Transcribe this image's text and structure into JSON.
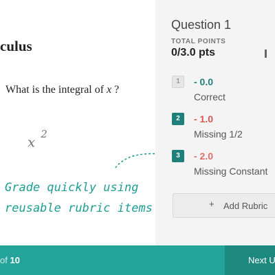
{
  "document": {
    "title": "culus",
    "question_prefix": "What is the integral of ",
    "question_var": "x",
    "question_suffix": " ?",
    "answer_base": "x",
    "answer_exponent": "2"
  },
  "annotation": {
    "line1": "Grade quickly using",
    "line2": "reusable rubric items",
    "color": "#1d9e93"
  },
  "grading_panel": {
    "question_title": "Question 1",
    "total_points_label": "TOTAL POINTS",
    "total_points_value": "0/3.0 pts",
    "rubric_items": [
      {
        "key": "1",
        "points": "- 0.0",
        "description": "Correct",
        "selected": false,
        "points_color": "#1f7f7a"
      },
      {
        "key": "2",
        "points": "- 1.0",
        "description": "Missing 1/2",
        "selected": true,
        "points_color": "#d9534f"
      },
      {
        "key": "3",
        "points": "- 2.0",
        "description": "Missing Constant",
        "selected": true,
        "points_color": "#e06b6b"
      }
    ],
    "add_rubric_icon": "plus-icon",
    "add_rubric_label": "Add Rubric"
  },
  "bottom_bar": {
    "counter_of": "of",
    "counter_total": "10",
    "next_label": "Next U",
    "accent_color": "#24a39b"
  }
}
